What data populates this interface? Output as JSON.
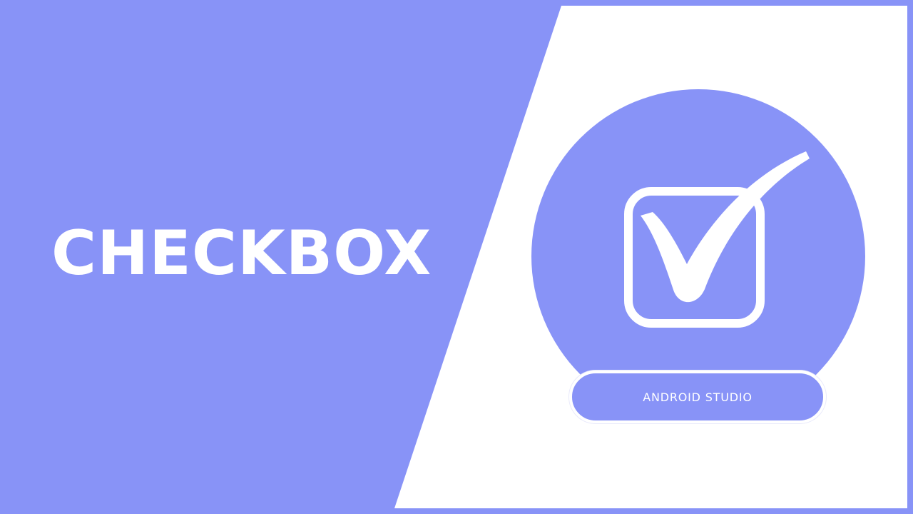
{
  "hero": {
    "title": "CHECKBOX",
    "badge_label": "ANDROID STUDIO",
    "icon": "checkbox-checked-icon"
  },
  "colors": {
    "accent": "#8893f7",
    "panel": "#ffffff",
    "text": "#ffffff"
  }
}
